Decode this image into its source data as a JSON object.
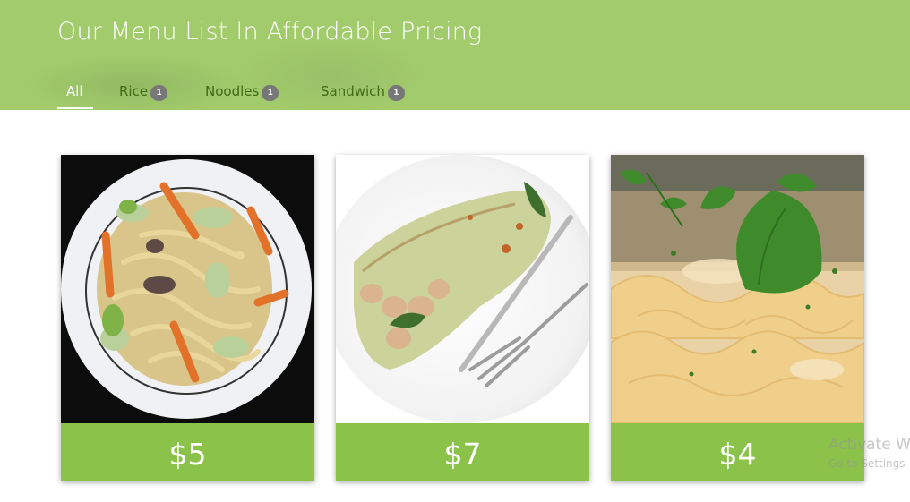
{
  "header": {
    "title": "Our Menu List In Affordable Pricing",
    "tabs": [
      {
        "label": "All",
        "count": null,
        "active": true
      },
      {
        "label": "Rice",
        "count": "1"
      },
      {
        "label": "Noodles",
        "count": "1"
      },
      {
        "label": "Sandwich",
        "count": "1"
      }
    ]
  },
  "items": [
    {
      "price": "$5",
      "image": "noodles-plate"
    },
    {
      "price": "$7",
      "image": "wrap-sandwich"
    },
    {
      "price": "$4",
      "image": "pasta-basil"
    }
  ],
  "watermark": {
    "line1": "Activate W",
    "line2": "Go to Settings"
  },
  "colors": {
    "header": "#a2cc6c",
    "price_bar": "#8bc34a",
    "badge": "#777777",
    "tab_text": "#3e6b14"
  }
}
